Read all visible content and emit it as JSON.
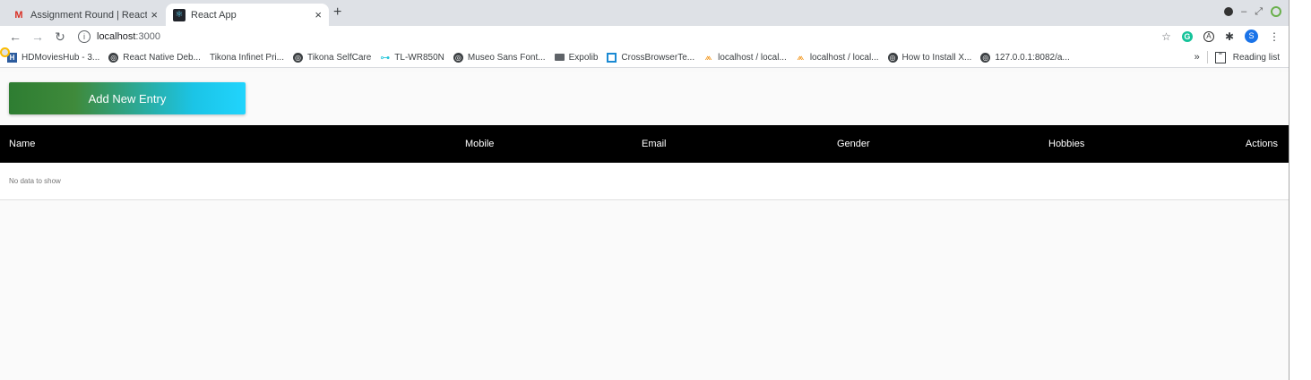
{
  "browser": {
    "tabs": [
      {
        "title": "Assignment Round | Reactjs |",
        "icon": "gmail-icon",
        "active": false
      },
      {
        "title": "React App",
        "icon": "react-icon",
        "active": true
      }
    ],
    "new_tab": "+",
    "close": "×",
    "address": {
      "host": "localhost",
      "port": ":3000"
    },
    "avatar_letter": "S",
    "bookmarks": [
      {
        "label": "HDMoviesHub - 3...",
        "icon": "hd-icon"
      },
      {
        "label": "React Native Deb...",
        "icon": "globe-icon"
      },
      {
        "label": "Tikona Infinet Pri...",
        "icon": "chrome-icon"
      },
      {
        "label": "Tikona SelfCare",
        "icon": "globe-icon"
      },
      {
        "label": "TL-WR850N",
        "icon": "tplink-icon"
      },
      {
        "label": "Museo Sans Font...",
        "icon": "globe-icon"
      },
      {
        "label": "Expolib",
        "icon": "folder-icon"
      },
      {
        "label": "CrossBrowserTe...",
        "icon": "crossbrowser-icon"
      },
      {
        "label": "localhost / local...",
        "icon": "phpmyadmin-icon"
      },
      {
        "label": "localhost / local...",
        "icon": "phpmyadmin-icon"
      },
      {
        "label": "How to Install X...",
        "icon": "globe-icon"
      },
      {
        "label": "127.0.0.1:8082/a...",
        "icon": "globe-icon"
      }
    ],
    "overflow": "»",
    "reading_list": "Reading list"
  },
  "app": {
    "add_button": "Add New Entry",
    "colors": {
      "gradient_start": "#2e7d32",
      "gradient_end": "#21d4fd",
      "header_bg": "#000000"
    },
    "table": {
      "columns": [
        "Name",
        "Mobile",
        "Email",
        "Gender",
        "Hobbies",
        "Actions"
      ],
      "empty_message": "No data to show"
    }
  }
}
